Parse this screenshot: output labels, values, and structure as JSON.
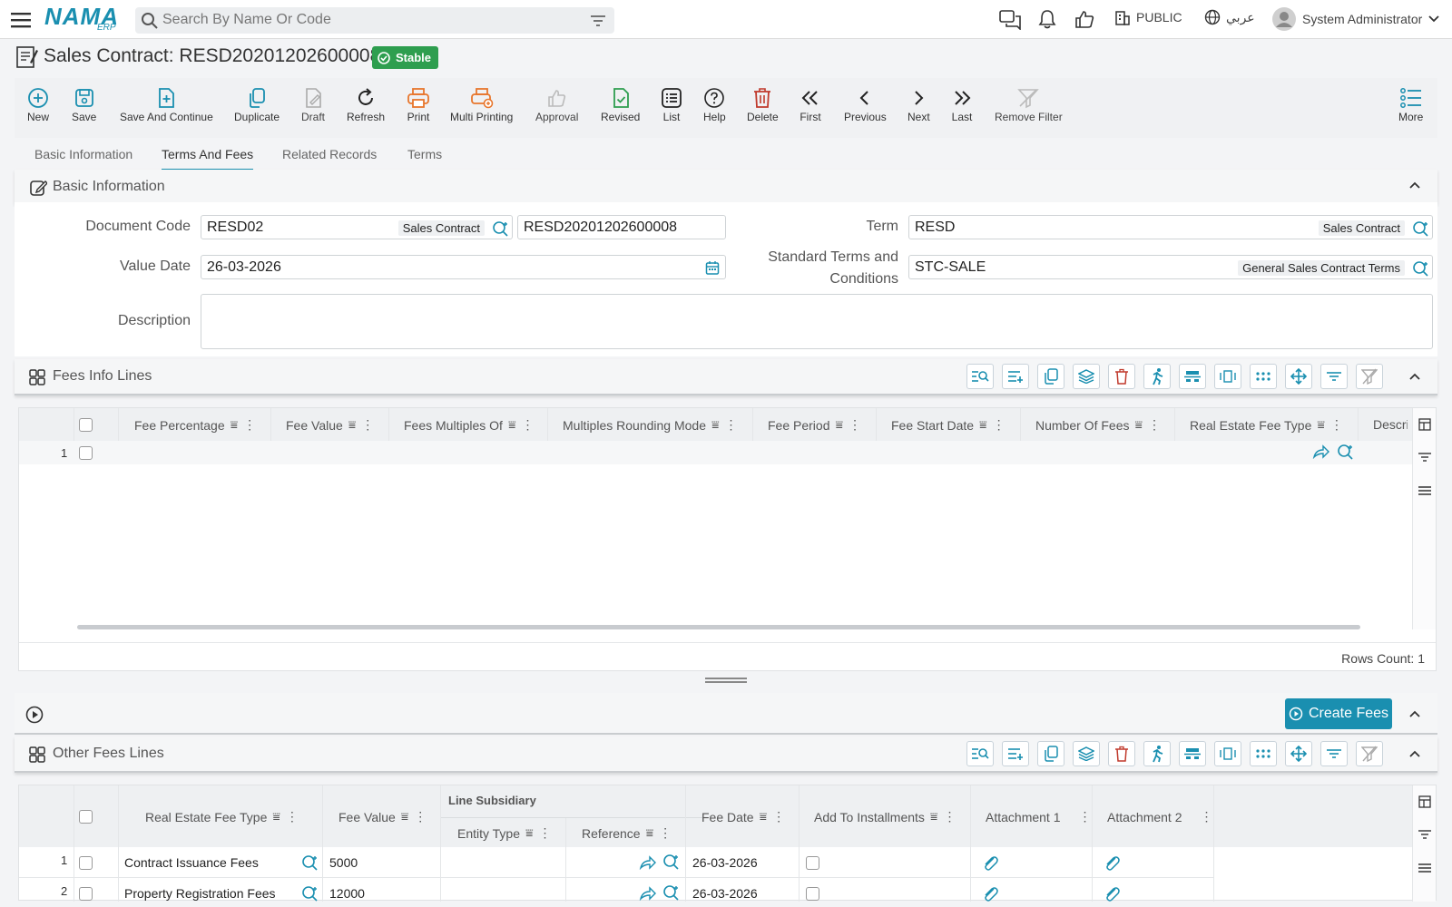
{
  "topbar": {
    "brand": "NAMA",
    "brand_sub": "ERP",
    "search_placeholder": "Search By Name Or Code",
    "public_label": "PUBLIC",
    "lang_label": "عربي",
    "user_name": "System Administrator"
  },
  "page": {
    "title": "Sales Contract: RESD20201202600008",
    "status": "Stable"
  },
  "toolbar": {
    "new": "New",
    "save": "Save",
    "save_continue": "Save And Continue",
    "duplicate": "Duplicate",
    "draft": "Draft",
    "refresh": "Refresh",
    "print": "Print",
    "multi_printing": "Multi Printing",
    "approval": "Approval",
    "revised": "Revised",
    "list": "List",
    "help": "Help",
    "delete": "Delete",
    "first": "First",
    "previous": "Previous",
    "next": "Next",
    "last": "Last",
    "remove_filter": "Remove Filter",
    "more": "More"
  },
  "tabs": [
    "Basic Information",
    "Terms And Fees",
    "Related Records",
    "Terms"
  ],
  "basic_info": {
    "title": "Basic Information",
    "document_code_label": "Document Code",
    "document_code": "RESD02",
    "document_code_tag": "Sales Contract",
    "document_number": "RESD20201202600008",
    "term_label": "Term",
    "term": "RESD",
    "term_tag": "Sales Contract",
    "value_date_label": "Value Date",
    "value_date": "26-03-2026",
    "std_terms_label_1": "Standard Terms and",
    "std_terms_label_2": "Conditions",
    "std_terms": "STC-SALE",
    "std_terms_tag": "General Sales Contract Terms",
    "description_label": "Description",
    "description": ""
  },
  "fees_info": {
    "title": "Fees Info Lines",
    "columns": [
      "Fee Percentage",
      "Fee Value",
      "Fees Multiples Of",
      "Multiples Rounding Mode",
      "Fee Period",
      "Fee Start Date",
      "Number Of Fees",
      "Real Estate Fee Type",
      "Descri"
    ],
    "rows": [
      {
        "num": "1"
      }
    ],
    "rows_count": "Rows Count: 1"
  },
  "action_bar": {
    "create_fees": "Create Fees"
  },
  "other_fees": {
    "title": "Other Fees Lines",
    "col_fee_type": "Real Estate Fee Type",
    "col_fee_value": "Fee Value",
    "group_line_subsidiary": "Line Subsidiary",
    "col_entity_type": "Entity Type",
    "col_reference": "Reference",
    "col_fee_date": "Fee Date",
    "col_add_installments": "Add To Installments",
    "col_attachment1": "Attachment 1",
    "col_attachment2": "Attachment 2",
    "rows": [
      {
        "num": "1",
        "fee_type": "Contract Issuance Fees",
        "fee_value": "5000",
        "fee_date": "26-03-2026"
      },
      {
        "num": "2",
        "fee_type": "Property Registration Fees",
        "fee_value": "12000",
        "fee_date": "26-03-2026"
      }
    ]
  },
  "colors": {
    "accent": "#1a8fb0",
    "stable": "#2e9e4f",
    "delete": "#c0392b",
    "print": "#e8762c"
  }
}
